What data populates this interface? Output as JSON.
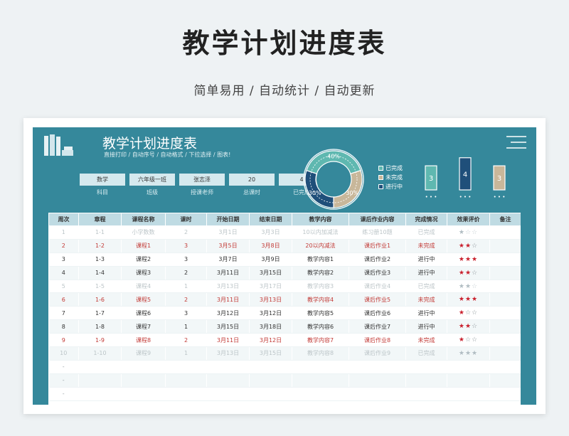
{
  "page": {
    "title": "教学计划进度表",
    "subtitle": "简单易用 / 自动统计 / 自动更新"
  },
  "sheet": {
    "title": "教学计划进度表",
    "tagline": "直接打印 / 自动序号 / 自动格式 / 下拉选择 / 图表!",
    "menu_icon": "hamburger-menu-icon",
    "books_icon": "books-icon"
  },
  "info": [
    {
      "value": "数学",
      "label": "科目"
    },
    {
      "value": "六年级一班",
      "label": "班级"
    },
    {
      "value": "张志泽",
      "label": "授课老师"
    },
    {
      "value": "20",
      "label": "总课时"
    },
    {
      "value": "4",
      "label": "已完成"
    }
  ],
  "donut": {
    "slices": [
      {
        "name": "已完成",
        "percent": 40,
        "label": "40%",
        "color": "#5fb8b0"
      },
      {
        "name": "未完成",
        "percent": 30,
        "label": "30%",
        "color": "#c8b79a"
      },
      {
        "name": "进行中",
        "percent": 30,
        "label": "30%",
        "color": "#1f4f7a"
      }
    ]
  },
  "legend": [
    {
      "label": "已完成",
      "color": "#5fb8b0"
    },
    {
      "label": "未完成",
      "color": "#c8b79a"
    },
    {
      "label": "进行中",
      "color": "#1f4f7a"
    }
  ],
  "chart_data": {
    "type": "bar",
    "values": [
      3,
      4,
      3
    ],
    "colors": [
      "#5fb8b0",
      "#1f4f7a",
      "#c8b79a"
    ],
    "ticks": [
      "• • •",
      "• • •",
      "• • •"
    ]
  },
  "table": {
    "headers": [
      "周次",
      "章程",
      "课程名称",
      "课时",
      "开始日期",
      "结束日期",
      "教学内容",
      "课后作业内容",
      "完成情况",
      "效果评价",
      "备注"
    ],
    "rows": [
      {
        "status": "done",
        "cells": [
          "1",
          "1-1",
          "小学数数",
          "2",
          "3月1日",
          "3月3日",
          "10以内加减法",
          "练习册10题",
          "已完成",
          "",
          ""
        ],
        "stars": 1
      },
      {
        "status": "late",
        "cells": [
          "2",
          "1-2",
          "课程1",
          "3",
          "3月5日",
          "3月8日",
          "20以内减法",
          "课后作业1",
          "未完成",
          "",
          ""
        ],
        "stars": 2
      },
      {
        "status": "normal",
        "cells": [
          "3",
          "1-3",
          "课程2",
          "3",
          "3月7日",
          "3月9日",
          "教学内容1",
          "课后作业2",
          "进行中",
          "",
          ""
        ],
        "stars": 3
      },
      {
        "status": "normal",
        "cells": [
          "4",
          "1-4",
          "课程3",
          "2",
          "3月11日",
          "3月15日",
          "教学内容2",
          "课后作业3",
          "进行中",
          "",
          ""
        ],
        "stars": 2
      },
      {
        "status": "done",
        "cells": [
          "5",
          "1-5",
          "课程4",
          "1",
          "3月13日",
          "3月17日",
          "教学内容3",
          "课后作业4",
          "已完成",
          "",
          ""
        ],
        "stars": 2
      },
      {
        "status": "late",
        "cells": [
          "6",
          "1-6",
          "课程5",
          "2",
          "3月11日",
          "3月13日",
          "教学内容4",
          "课后作业5",
          "未完成",
          "",
          ""
        ],
        "stars": 3
      },
      {
        "status": "normal",
        "cells": [
          "7",
          "1-7",
          "课程6",
          "3",
          "3月12日",
          "3月12日",
          "教学内容5",
          "课后作业6",
          "进行中",
          "",
          ""
        ],
        "stars": 1
      },
      {
        "status": "normal",
        "cells": [
          "8",
          "1-8",
          "课程7",
          "1",
          "3月15日",
          "3月18日",
          "教学内容6",
          "课后作业7",
          "进行中",
          "",
          ""
        ],
        "stars": 2
      },
      {
        "status": "late",
        "cells": [
          "9",
          "1-9",
          "课程8",
          "2",
          "3月11日",
          "3月12日",
          "教学内容7",
          "课后作业8",
          "未完成",
          "",
          ""
        ],
        "stars": 1
      },
      {
        "status": "done",
        "cells": [
          "10",
          "1-10",
          "课程9",
          "1",
          "3月13日",
          "3月15日",
          "教学内容8",
          "课后作业9",
          "已完成",
          "",
          ""
        ],
        "stars": 3
      },
      {
        "status": "empty",
        "cells": [
          "-",
          "",
          "",
          "",
          "",
          "",
          "",
          "",
          "",
          "",
          ""
        ],
        "stars": 0
      },
      {
        "status": "empty",
        "cells": [
          "-",
          "",
          "",
          "",
          "",
          "",
          "",
          "",
          "",
          "",
          ""
        ],
        "stars": 0
      },
      {
        "status": "empty",
        "cells": [
          "-",
          "",
          "",
          "",
          "",
          "",
          "",
          "",
          "",
          "",
          ""
        ],
        "stars": 0
      }
    ]
  }
}
